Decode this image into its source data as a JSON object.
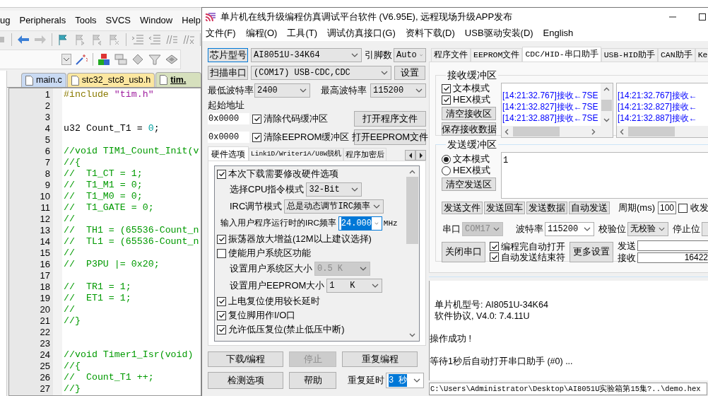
{
  "ide": {
    "menu": [
      "ug",
      "Peripherals",
      "Tools",
      "SVCS",
      "Window",
      "Help"
    ],
    "tabs": [
      {
        "label": "main.c",
        "selected": false,
        "color": "#c9daf3"
      },
      {
        "label": "stc32_stc8_usb.h",
        "selected": false,
        "color": "#fce7a0"
      },
      {
        "label": "tim.",
        "selected": true,
        "color": "#d6e0bd"
      }
    ],
    "code": [
      {
        "line": "1",
        "parts": [
          {
            "kind": "directive",
            "text": "#include "
          },
          {
            "kind": "string",
            "text": "\"tim.h\""
          }
        ]
      },
      {
        "line": "2"
      },
      {
        "line": "3"
      },
      {
        "line": "4",
        "parts": [
          {
            "kind": "plain",
            "text": "u32 Count_T1 = "
          },
          {
            "kind": "number",
            "text": "0"
          },
          {
            "kind": "plain",
            "text": ";"
          }
        ]
      },
      {
        "line": "5"
      },
      {
        "line": "6",
        "parts": [
          {
            "kind": "comment",
            "text": "//void TIM1_Count_Init(v"
          }
        ]
      },
      {
        "line": "7",
        "parts": [
          {
            "kind": "comment",
            "text": "//{"
          }
        ]
      },
      {
        "line": "8",
        "parts": [
          {
            "kind": "comment",
            "text": "//  T1_CT = 1;"
          }
        ]
      },
      {
        "line": "9",
        "parts": [
          {
            "kind": "comment",
            "text": "//  T1_M1 = 0;"
          }
        ]
      },
      {
        "line": "10",
        "parts": [
          {
            "kind": "comment",
            "text": "//  T1_M0 = 0;"
          }
        ]
      },
      {
        "line": "11",
        "parts": [
          {
            "kind": "comment",
            "text": "//  T1_GATE = 0;"
          }
        ]
      },
      {
        "line": "12",
        "parts": [
          {
            "kind": "comment",
            "text": "//"
          }
        ]
      },
      {
        "line": "13",
        "parts": [
          {
            "kind": "comment",
            "text": "//  TH1 = (65536-Count_n"
          }
        ]
      },
      {
        "line": "14",
        "parts": [
          {
            "kind": "comment",
            "text": "//  TL1 = (65536-Count_n"
          }
        ]
      },
      {
        "line": "15",
        "parts": [
          {
            "kind": "comment",
            "text": "//"
          }
        ]
      },
      {
        "line": "16",
        "parts": [
          {
            "kind": "comment",
            "text": "//  P3PU |= 0x20;"
          }
        ]
      },
      {
        "line": "17"
      },
      {
        "line": "18",
        "parts": [
          {
            "kind": "comment",
            "text": "//  TR1 = 1;"
          }
        ]
      },
      {
        "line": "19",
        "parts": [
          {
            "kind": "comment",
            "text": "//  ET1 = 1;"
          }
        ]
      },
      {
        "line": "20",
        "parts": [
          {
            "kind": "comment",
            "text": "//"
          }
        ]
      },
      {
        "line": "21",
        "parts": [
          {
            "kind": "comment",
            "text": "//}"
          }
        ]
      },
      {
        "line": "22"
      },
      {
        "line": "23"
      },
      {
        "line": "24",
        "parts": [
          {
            "kind": "comment",
            "text": "//void Timer1_Isr(void)"
          }
        ]
      },
      {
        "line": "25",
        "parts": [
          {
            "kind": "comment",
            "text": "//{"
          }
        ]
      },
      {
        "line": "26",
        "parts": [
          {
            "kind": "comment",
            "text": "//  Count_T1 ++;"
          }
        ]
      },
      {
        "line": "27",
        "parts": [
          {
            "kind": "comment",
            "text": "//}"
          }
        ]
      }
    ]
  },
  "programmer": {
    "title": "单片机在线升级编程仿真调试平台软件 (V6.95E), 远程现场升级APP发布",
    "menu": [
      "文件(F)",
      "编程(O)",
      "工具(T)",
      "调试仿真接口(G)",
      "资料下载(D)",
      "USB驱动安装(D)",
      "English"
    ],
    "chip_button": "芯片型号",
    "chip": "AI8051U-34K64",
    "pins_label": "引脚数",
    "pins": "Auto",
    "scan_button": "扫描串口",
    "port": "(COM17) USB-CDC,CDC",
    "settings_button": "设置",
    "min_baud_label": "最低波特率",
    "min_baud": "2400",
    "max_baud_label": "最高波特率",
    "max_baud": "115200",
    "start_address_label": "起始地址",
    "buffers": [
      {
        "address": "0x0000",
        "label": "清除代码缓冲区",
        "checked": true,
        "button": "打开程序文件"
      },
      {
        "address": "0x0000",
        "label": "清除EEPROM缓冲区",
        "checked": true,
        "button": "打开EEPROM文件"
      }
    ],
    "option_tabs": [
      {
        "label": "硬件选项",
        "selected": true
      },
      {
        "label": "Link1D/Writer1A/U8W脱机",
        "selected": false
      },
      {
        "label": "程序加密后",
        "selected": false
      }
    ],
    "hardware_options": [
      {
        "kind": "checkbox",
        "label": "本次下载需要修改硬件选项",
        "checked": true
      },
      {
        "kind": "select",
        "label": "选择CPU指令模式",
        "value": "32-Bit",
        "disabled": false
      },
      {
        "kind": "select",
        "label": "IRC调节模式",
        "value": "总是动态调节IRC频率",
        "disabled": false
      },
      {
        "kind": "combo",
        "label": "输入用户程序运行时的IRC频率",
        "value": "24.000",
        "unit": "MHz",
        "focused": true
      },
      {
        "kind": "checkbox",
        "label": "振荡器放大增益(12M以上建议选择)",
        "checked": true
      },
      {
        "kind": "checkbox",
        "label": "使能用户系统区功能",
        "checked": false
      },
      {
        "kind": "select",
        "label": "设置用户系统区大小",
        "value": "0.5 K",
        "disabled": true
      },
      {
        "kind": "select",
        "label": "设置用户EEPROM大小",
        "value": "1   K",
        "disabled": false
      },
      {
        "kind": "checkbox",
        "label": "上电复位使用较长延时",
        "checked": true
      },
      {
        "kind": "checkbox",
        "label": "复位脚用作I/O口",
        "checked": true
      },
      {
        "kind": "checkbox",
        "label": "允许低压复位(禁止低压中断)",
        "checked": true
      }
    ],
    "actions": [
      {
        "label": "下载/编程",
        "disabled": false
      },
      {
        "label": "停止",
        "disabled": true
      },
      {
        "label": "重复编程",
        "disabled": false
      }
    ],
    "tools": [
      {
        "label": "检测选项",
        "disabled": false
      },
      {
        "label": "帮助",
        "disabled": false
      }
    ],
    "repeat_delay": {
      "label": "重复延时",
      "value": "3 秒",
      "focused": true
    },
    "tool_tabs": [
      {
        "label": "程序文件",
        "selected": false
      },
      {
        "label": "EEPROM文件",
        "selected": false
      },
      {
        "label": "CDC/HID-串口助手",
        "selected": true
      },
      {
        "label": "USB-HID助手",
        "selected": false
      },
      {
        "label": "CAN助手",
        "selected": false
      },
      {
        "label": "Ke",
        "selected": false
      }
    ],
    "receive": {
      "title": "接收缓冲区",
      "modes": [
        {
          "label": "文本模式",
          "checked": true
        },
        {
          "label": "HEX模式",
          "checked": true
        }
      ],
      "buttons": [
        "清空接收区",
        "保存接收数据"
      ],
      "panes": [
        {
          "lines": [
            "[14:21:32.767]接收←7SE",
            "[14:21:32.827]接收←7SE",
            "[14:21:32.887]接收←7SE"
          ]
        },
        {
          "lines": [
            "[14:21:32.767]接收←",
            "[14:21:32.827]接收←",
            "[14:21:32.887]接收←"
          ]
        }
      ]
    },
    "send": {
      "title": "发送缓冲区",
      "modes": [
        {
          "label": "文本模式",
          "selected": true
        },
        {
          "label": "HEX模式",
          "selected": false
        }
      ],
      "clear_button": "清空发送区",
      "text": "1",
      "buttons": [
        "发送文件",
        "发送回车",
        "发送数据",
        "自动发送"
      ],
      "period_label": "周期(ms)",
      "period": "100",
      "duplex": {
        "label": "收发",
        "checked": false
      }
    },
    "serial": [
      {
        "label": "串口",
        "value": "COM17",
        "disabled": true
      },
      {
        "label": "波特率",
        "value": "115200",
        "disabled": false
      },
      {
        "label": "校验位",
        "value": "无校验",
        "disabled": false
      },
      {
        "label": "停止位",
        "disabled": false
      }
    ],
    "close_button": "关闭串口",
    "auto_options": [
      {
        "label": "编程完自动打开",
        "checked": true
      },
      {
        "label": "自动发送结束符",
        "checked": true
      }
    ],
    "more_button": "更多设置",
    "counters": [
      {
        "label": "发送"
      },
      {
        "label": "接收",
        "value": "16422"
      }
    ],
    "log": [
      [
        "  单片机型号: AI8051U-34K64",
        "  软件协议, V4.0: 7.4.11U"
      ],
      [
        "操作成功 !"
      ],
      [
        "等待1秒后自动打开串口助手 (#0) ..."
      ]
    ],
    "path": "C:\\Users\\Administrator\\Desktop\\AI8051U实验箱第15集?..\\demo.hex"
  }
}
